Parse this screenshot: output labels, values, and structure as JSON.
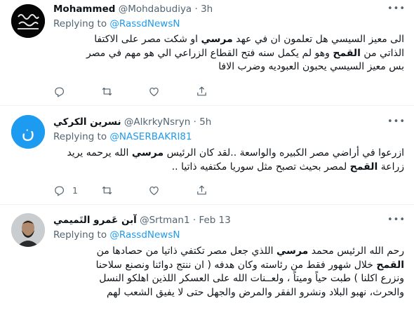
{
  "tweets": [
    {
      "name": "Mohammed",
      "handle": "@Mohdabudiya",
      "time": "3h",
      "reply_prefix": "Replying to",
      "reply_to": "@RassdNewsN",
      "avatar_caption": "",
      "lines": [
        [
          {
            "t": "الى معيز السيسي هل تعلمون ان في عهد "
          },
          {
            "t": "مرسي",
            "b": true
          },
          {
            "t": " او شكت مصر على الاكتفا"
          }
        ],
        [
          {
            "t": "الذاتي من "
          },
          {
            "t": "القمح",
            "b": true
          },
          {
            "t": " وهو لم يكمل سنه فتح القطاع الزراعي الي هو مهم في مصر"
          }
        ],
        [
          {
            "t": "بس معيز السيسي يحبون العبوديه وضرب الافا"
          }
        ]
      ],
      "actions": {
        "reply": "",
        "retweet": "",
        "like": ""
      }
    },
    {
      "name": "نسرين الكركي",
      "handle": "@AlkrkyNsryn",
      "time": "5h",
      "reply_prefix": "Replying to",
      "reply_to": "@NASERBAKRI81",
      "avatar_letter": "ن",
      "lines": [
        [
          {
            "t": "ازرعوا في أراضي مصر الكبيره والواسعة ..لقد كان الرئيس "
          },
          {
            "t": "مرسي",
            "b": true
          },
          {
            "t": " الله يرحمه يريد"
          }
        ],
        [
          {
            "t": "زراعة "
          },
          {
            "t": "القمح",
            "b": true
          },
          {
            "t": " لمصر بحيث تصبح مثل سوريا مكتفيه ذاتيا .."
          }
        ]
      ],
      "actions": {
        "reply": "1",
        "retweet": "",
        "like": ""
      }
    },
    {
      "name": "آبن عَمرو التَميمي",
      "handle": "@Srtman1",
      "time": "Feb 13",
      "reply_prefix": "Replying to",
      "reply_to": "@RassdNewsN",
      "lines": [
        [
          {
            "t": "رحم الله الرئيس محمد "
          },
          {
            "t": "مرسي",
            "b": true
          },
          {
            "t": " اللذي جعل مصر تكتفي ذاتيا من حصادها من"
          }
        ],
        [
          {
            "t": "القمح",
            "b": true
          },
          {
            "t": " خلال شهور فقط من رئاسته وكان هدفه ( ان ننتج دوائنا ونصنع سلاحنا"
          }
        ],
        [
          {
            "t": "ونزرع اكلنا ) طبت حياً وميتاً ، ولعــنات الله على العسكر اللذين اهلكو النسل"
          }
        ],
        [
          {
            "t": "والحرث، نهبو البلاد ونشرو الفقر والمرض والجهل حتى لا يفيق الشعب لهم"
          }
        ]
      ],
      "actions": {
        "reply": "",
        "retweet": "",
        "like": ""
      }
    }
  ],
  "icons": [
    "reply-icon",
    "retweet-icon",
    "like-icon",
    "share-icon",
    "more-icon"
  ],
  "colors": {
    "link": "#1d9bf0",
    "secondary": "#536471",
    "text": "#0f1419",
    "divider": "#eff3f4"
  }
}
